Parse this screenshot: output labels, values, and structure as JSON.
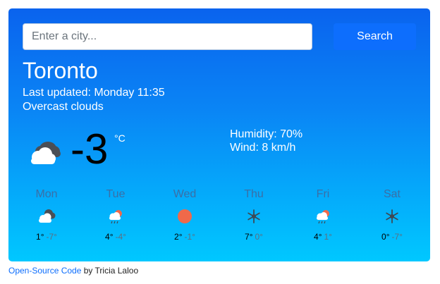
{
  "search": {
    "placeholder": "Enter a city...",
    "value": "",
    "button_label": "Search"
  },
  "current": {
    "city": "Toronto",
    "last_updated": "Last updated: Monday 11:35",
    "description": "Overcast clouds",
    "temperature": "-3",
    "unit": "°C",
    "humidity": "Humidity: 70%",
    "wind": "Wind: 8 km/h",
    "icon": "overcast-clouds-icon"
  },
  "forecast": [
    {
      "day": "Mon",
      "high": "1°",
      "low": "-7°",
      "icon": "overcast-clouds-icon"
    },
    {
      "day": "Tue",
      "high": "4°",
      "low": "-4°",
      "icon": "sun-cloud-rain-icon"
    },
    {
      "day": "Wed",
      "high": "2°",
      "low": "-1°",
      "icon": "sun-icon"
    },
    {
      "day": "Thu",
      "high": "7°",
      "low": "0°",
      "icon": "snowflake-icon"
    },
    {
      "day": "Fri",
      "high": "4°",
      "low": "1°",
      "icon": "sun-cloud-rain-icon"
    },
    {
      "day": "Sat",
      "high": "0°",
      "low": "-7°",
      "icon": "snowflake-icon"
    }
  ],
  "footer": {
    "link_text": "Open-Source Code",
    "suffix": " by Tricia Laloo"
  },
  "colors": {
    "gradient_top": "#0a63ee",
    "gradient_bottom": "#00c8ff",
    "button": "#0d6efd",
    "sun": "#f0694a",
    "snow": "#3d4a55"
  }
}
